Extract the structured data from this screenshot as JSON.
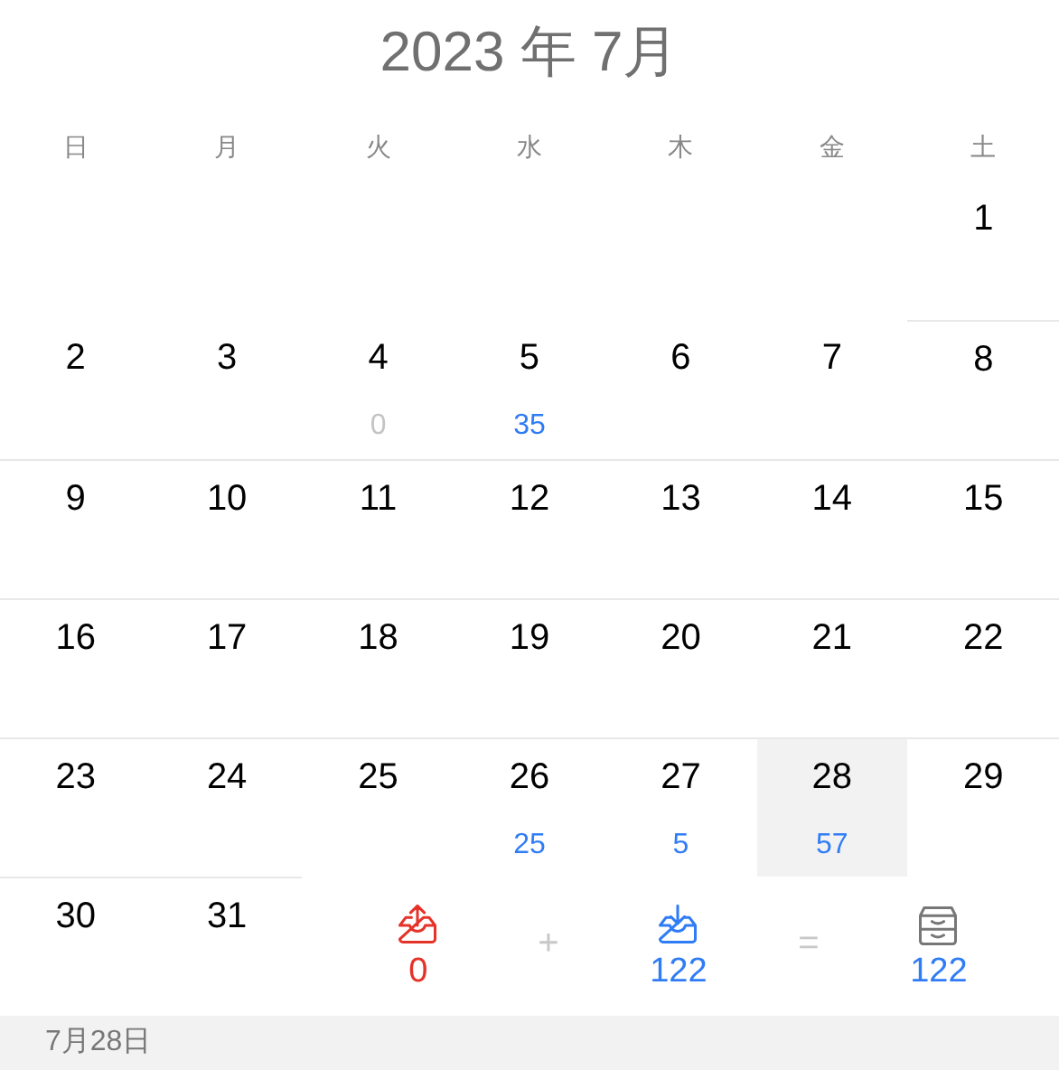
{
  "title": "2023 年 7月",
  "weekdays": [
    "日",
    "月",
    "火",
    "水",
    "木",
    "金",
    "土"
  ],
  "weeks": [
    [
      {
        "kind": "blank"
      },
      {
        "kind": "blank"
      },
      {
        "kind": "blank"
      },
      {
        "kind": "blank"
      },
      {
        "kind": "blank"
      },
      {
        "kind": "blank"
      },
      {
        "kind": "day",
        "label": "1",
        "selected": false
      }
    ],
    [
      {
        "kind": "day",
        "label": "2",
        "selected": false
      },
      {
        "kind": "day",
        "label": "3",
        "selected": false
      },
      {
        "kind": "day",
        "label": "4",
        "selected": false,
        "count": "0",
        "dimmed": true
      },
      {
        "kind": "day",
        "label": "5",
        "selected": false,
        "count": "35",
        "dimmed": false
      },
      {
        "kind": "day",
        "label": "6",
        "selected": false
      },
      {
        "kind": "day",
        "label": "7",
        "selected": false
      },
      {
        "kind": "day",
        "label": "8",
        "selected": false
      }
    ],
    [
      {
        "kind": "day",
        "label": "9",
        "selected": false
      },
      {
        "kind": "day",
        "label": "10",
        "selected": false
      },
      {
        "kind": "day",
        "label": "11",
        "selected": false
      },
      {
        "kind": "day",
        "label": "12",
        "selected": false
      },
      {
        "kind": "day",
        "label": "13",
        "selected": false
      },
      {
        "kind": "day",
        "label": "14",
        "selected": false
      },
      {
        "kind": "day",
        "label": "15",
        "selected": false
      }
    ],
    [
      {
        "kind": "day",
        "label": "16",
        "selected": false
      },
      {
        "kind": "day",
        "label": "17",
        "selected": false
      },
      {
        "kind": "day",
        "label": "18",
        "selected": false
      },
      {
        "kind": "day",
        "label": "19",
        "selected": false
      },
      {
        "kind": "day",
        "label": "20",
        "selected": false
      },
      {
        "kind": "day",
        "label": "21",
        "selected": false
      },
      {
        "kind": "day",
        "label": "22",
        "selected": false
      }
    ],
    [
      {
        "kind": "day",
        "label": "23",
        "selected": false
      },
      {
        "kind": "day",
        "label": "24",
        "selected": false
      },
      {
        "kind": "day",
        "label": "25",
        "selected": false
      },
      {
        "kind": "day",
        "label": "26",
        "selected": false,
        "count": "25",
        "dimmed": false
      },
      {
        "kind": "day",
        "label": "27",
        "selected": false,
        "count": "5",
        "dimmed": false
      },
      {
        "kind": "day",
        "label": "28",
        "selected": true,
        "count": "57",
        "dimmed": false
      },
      {
        "kind": "day",
        "label": "29",
        "selected": false
      }
    ],
    [
      {
        "kind": "day",
        "label": "30",
        "selected": false
      },
      {
        "kind": "day",
        "label": "31",
        "selected": false
      }
    ]
  ],
  "summary": [
    {
      "kind": "outgoing",
      "value": "0"
    },
    {
      "kind": "operator",
      "value": "+"
    },
    {
      "kind": "incoming",
      "value": "122"
    },
    {
      "kind": "operator",
      "value": "="
    },
    {
      "kind": "total",
      "value": "122"
    }
  ],
  "footer": {
    "date": "7月28日"
  }
}
